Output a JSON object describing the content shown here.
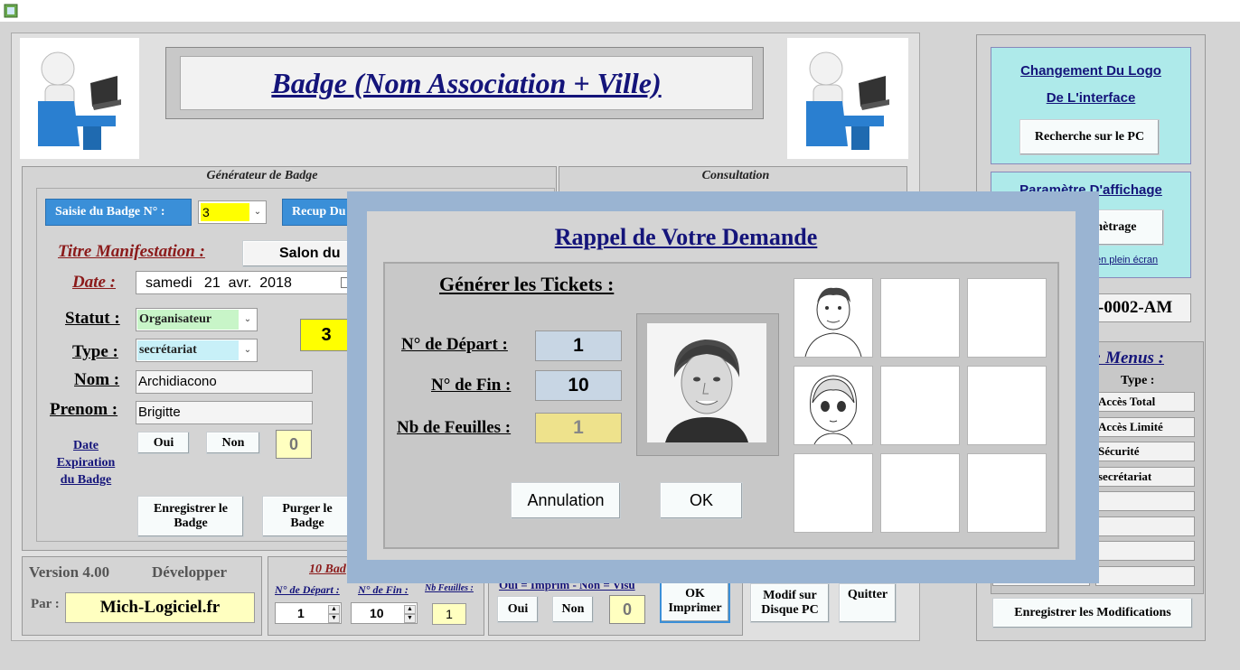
{
  "app": {
    "title": "Badge (Nom Association + Ville)"
  },
  "generator": {
    "section_title": "Générateur de Badge",
    "saisie_label": "Saisie du Badge N° :",
    "saisie_value": "3",
    "recup_label": "Recup Du",
    "titre_label": "Titre Manifestation :",
    "titre_value": "Salon du",
    "date_label": "Date :",
    "date_value": "samedi   21  avr.  2018",
    "statut_label": "Statut :",
    "statut_value": "Organisateur",
    "type_label": "Type :",
    "type_value": "secrétariat",
    "badge_number": "3",
    "nom_label": "Nom :",
    "nom_value": "Archidiacono",
    "prenom_label": "Prenom :",
    "prenom_value": "Brigitte",
    "expiration_label_1": "Date",
    "expiration_label_2": "Expiration",
    "expiration_label_3": "du Badge",
    "oui": "Oui",
    "non": "Non",
    "expiration_count": "0",
    "save_label_1": "Enregistrer le",
    "save_label_2": "Badge",
    "purge_label_1": "Purger le",
    "purge_label_2": "Badge"
  },
  "consultation": {
    "section_title": "Consultation"
  },
  "footer": {
    "version": "Version 4.00",
    "developer": "Développer",
    "par_label": "Par :",
    "author": "Mich-Logiciel.fr",
    "tickets_title": "10 Bad",
    "depart_label": "N° de Départ :",
    "depart_value": "1",
    "fin_label": "N° de Fin :",
    "fin_value": "10",
    "feuilles_label": "Nb Feuilles :",
    "feuilles_value": "1",
    "print_hint": "Oui = Imprim - Non = Visu",
    "oui": "Oui",
    "non": "Non",
    "count": "0",
    "ok_label": "OK",
    "imprimer_label": "Imprimer",
    "modif_label_1": "Modif sur",
    "modif_label_2": "Disque PC",
    "quit_label": "Quitter"
  },
  "right_panel": {
    "logo_title_1": "Changement Du Logo",
    "logo_title_2": "De L'interface",
    "search_pc": "Recherche sur le PC",
    "display_title": "Paramètre D'affichage",
    "param_button": "mètrage",
    "fullscreen_link": "en plein écran",
    "code": "-0002-AM",
    "menus_title": ": Menus :",
    "type_header": "Type :",
    "access_items": [
      "Accès Total",
      "Accès Limité",
      "Sécurité",
      "secrétariat",
      "",
      "",
      "",
      ""
    ],
    "save_mods": "Enregistrer les Modifications"
  },
  "dialog": {
    "title": "Rappel de Votre Demande",
    "subtitle": "Générer les Tickets :",
    "depart_label": "N° de Départ :",
    "depart_value": "1",
    "fin_label": "N° de Fin :",
    "fin_value": "10",
    "feuilles_label": "Nb de Feuilles :",
    "feuilles_value": "1",
    "cancel": "Annulation",
    "ok": "OK"
  },
  "colors": {
    "yellow": "#ffff00",
    "light_yellow": "#ffffc0",
    "cyan_panel": "#aeeaea",
    "green_field": "#c8f5c8",
    "cyan_field": "#c8f0f8",
    "dialog_frame": "#9ab4d2",
    "title_blue": "#1a1a8a",
    "maroon": "#8b1a1a"
  }
}
